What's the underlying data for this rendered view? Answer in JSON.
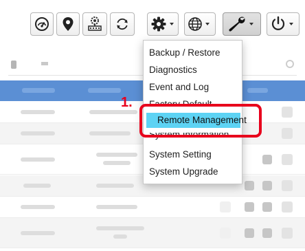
{
  "toolbar": {
    "buttons": [
      {
        "icon": "dashboard-gauge-icon"
      },
      {
        "icon": "location-pin-icon"
      },
      {
        "icon": "network-device-icon"
      },
      {
        "icon": "refresh-icon"
      },
      {
        "icon": "gear-icon"
      },
      {
        "icon": "globe-icon"
      },
      {
        "icon": "wrench-icon"
      },
      {
        "icon": "power-icon"
      }
    ]
  },
  "menu": {
    "items": [
      {
        "label": "Backup / Restore"
      },
      {
        "label": "Diagnostics"
      },
      {
        "label": "Event and Log"
      },
      {
        "label": "Factory Default"
      },
      {
        "label": "Remote Management",
        "highlighted": true
      },
      {
        "label": "System Information"
      },
      {
        "label": "System Setting"
      },
      {
        "label": "System Upgrade"
      }
    ]
  },
  "annotation": {
    "step": "1."
  },
  "colors": {
    "highlight": "#5dd3f4",
    "callout": "#e8001c",
    "table_header": "#5b8fd4"
  }
}
